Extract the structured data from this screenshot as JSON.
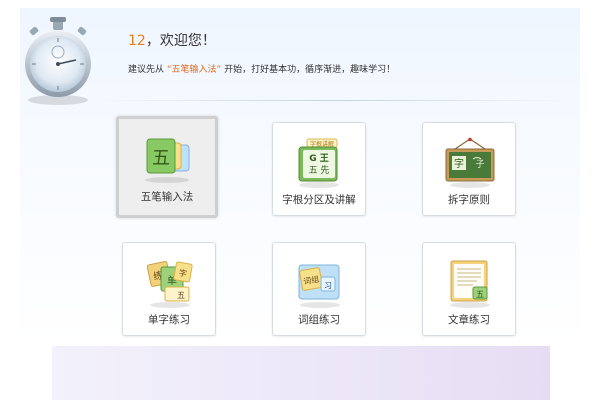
{
  "header": {
    "user": "12",
    "greeting_suffix": "，欢迎您！",
    "subtitle_prefix": "建议先从",
    "subtitle_highlight": "“五笔输入法”",
    "subtitle_suffix": "开始，打好基本功，循序渐进，趣味学习！"
  },
  "tiles": [
    {
      "label": "五笔输入法",
      "icon": "wubi-cards-icon",
      "selected": true,
      "glyph": "五"
    },
    {
      "label": "字根分区及讲解",
      "icon": "radicals-book-icon",
      "selected": false,
      "glyph_a": "G 王",
      "glyph_b": "五 先",
      "tag": "字根讲解"
    },
    {
      "label": "拆字原则",
      "icon": "blackboard-icon",
      "selected": false,
      "glyph_a": "字",
      "glyph_b": "子"
    },
    {
      "label": "单字练习",
      "icon": "single-char-cards-icon",
      "selected": false,
      "glyph_a": "练",
      "glyph_b": "单",
      "glyph_c": "字",
      "glyph_d": "五"
    },
    {
      "label": "词组练习",
      "icon": "phrase-cards-icon",
      "selected": false,
      "glyph_a": "词组",
      "glyph_b": "习"
    },
    {
      "label": "文章练习",
      "icon": "article-paper-icon",
      "selected": false,
      "glyph_a": "五"
    }
  ],
  "colors": {
    "accent_orange": "#e8801a",
    "green_card": "#7cc35a",
    "blackboard": "#4a7a3a"
  }
}
